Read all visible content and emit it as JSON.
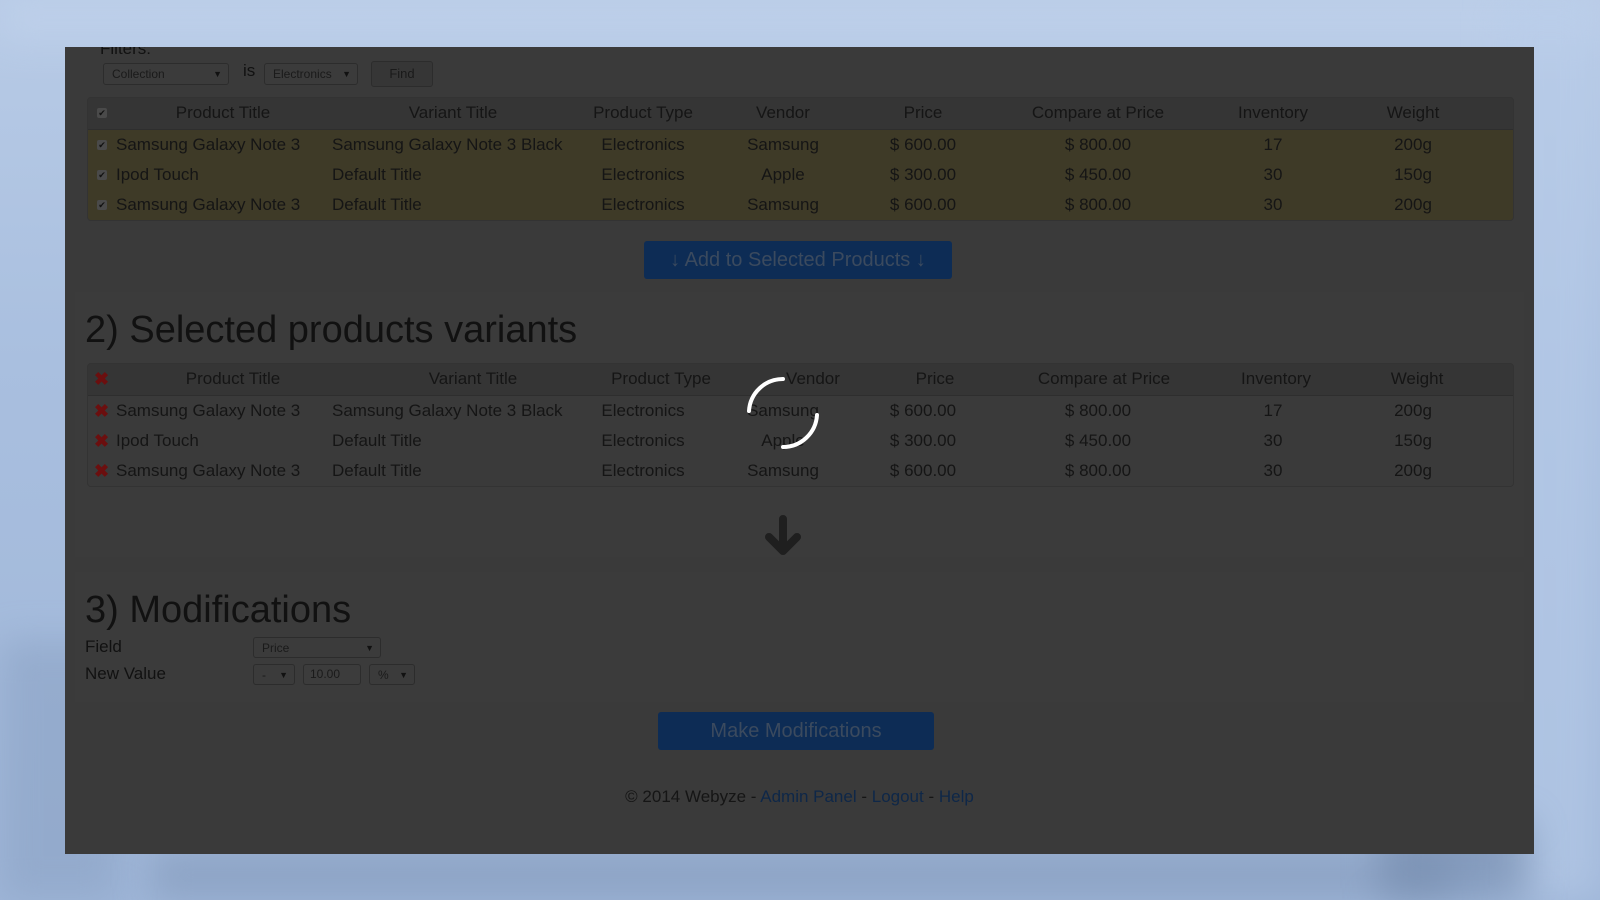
{
  "filters": {
    "label": "Filters:",
    "field_select": "Collection",
    "operator_label": "is",
    "value_select": "Electronics",
    "find_label": "Find"
  },
  "columns": [
    "Product Title",
    "Variant Title",
    "Product Type",
    "Vendor",
    "Price",
    "Compare at Price",
    "Inventory",
    "Weight"
  ],
  "search_results": [
    {
      "product_title": "Samsung Galaxy Note 3",
      "variant_title": "Samsung Galaxy Note 3 Black",
      "product_type": "Electronics",
      "vendor": "Samsung",
      "price": "$ 600.00",
      "compare_at_price": "$ 800.00",
      "inventory": "17",
      "weight": "200g",
      "checked": true
    },
    {
      "product_title": "Ipod Touch",
      "variant_title": "Default Title",
      "product_type": "Electronics",
      "vendor": "Apple",
      "price": "$ 300.00",
      "compare_at_price": "$ 450.00",
      "inventory": "30",
      "weight": "150g",
      "checked": true
    },
    {
      "product_title": "Samsung Galaxy Note 3",
      "variant_title": "Default Title",
      "product_type": "Electronics",
      "vendor": "Samsung",
      "price": "$ 600.00",
      "compare_at_price": "$ 800.00",
      "inventory": "30",
      "weight": "200g",
      "checked": true
    }
  ],
  "add_button": {
    "label": "↓ Add to Selected Products ↓"
  },
  "selected_section": {
    "heading": "2) Selected products variants"
  },
  "selected_variants": [
    {
      "product_title": "Samsung Galaxy Note 3",
      "variant_title": "Samsung Galaxy Note 3 Black",
      "product_type": "Electronics",
      "vendor": "Samsung",
      "price": "$ 600.00",
      "compare_at_price": "$ 800.00",
      "inventory": "17",
      "weight": "200g"
    },
    {
      "product_title": "Ipod Touch",
      "variant_title": "Default Title",
      "product_type": "Electronics",
      "vendor": "Apple",
      "price": "$ 300.00",
      "compare_at_price": "$ 450.00",
      "inventory": "30",
      "weight": "150g"
    },
    {
      "product_title": "Samsung Galaxy Note 3",
      "variant_title": "Default Title",
      "product_type": "Electronics",
      "vendor": "Samsung",
      "price": "$ 600.00",
      "compare_at_price": "$ 800.00",
      "inventory": "30",
      "weight": "200g"
    }
  ],
  "modifications": {
    "heading": "3) Modifications",
    "field_label": "Field",
    "field_value": "Price",
    "new_value_label": "New Value",
    "operation": "-",
    "amount": "10.00",
    "unit": "%",
    "submit_label": "Make Modifications"
  },
  "footer": {
    "copyright": "© 2014 Webyze - ",
    "sep": " - ",
    "links": [
      "Admin Panel",
      "Logout",
      "Help"
    ]
  },
  "icons": {
    "check": "✔",
    "remove": "✖",
    "caret": "▼"
  },
  "colors": {
    "accent_button": "#0d2c55",
    "remove_icon": "#6b0f0f",
    "highlight_row": "#3e3a27",
    "link": "#0e2748"
  }
}
